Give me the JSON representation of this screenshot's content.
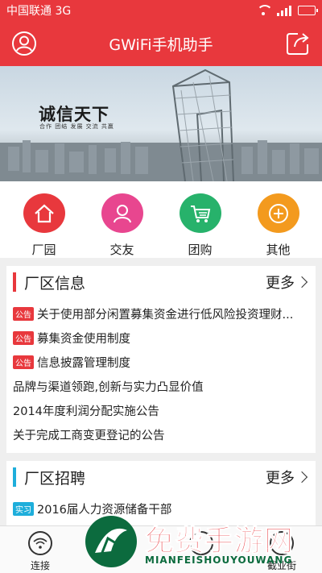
{
  "status_bar": {
    "carrier": "中国联通 3G",
    "battery_level": 0.9
  },
  "header": {
    "title": "GWiFi手机助手",
    "left_icon": "user-icon",
    "right_icon": "share-icon"
  },
  "banner": {
    "slogan": "诚信天下",
    "slogan_sub": "合作 团结 发展 交流 共赢"
  },
  "quick_menu": [
    {
      "label": "厂园",
      "icon": "home-icon",
      "color": "#e8383d"
    },
    {
      "label": "交友",
      "icon": "friends-icon",
      "color": "#e8468f"
    },
    {
      "label": "团购",
      "icon": "cart-icon",
      "color": "#27b26b"
    },
    {
      "label": "其他",
      "icon": "plus-icon",
      "color": "#f39a1e"
    }
  ],
  "news": {
    "title": "厂区信息",
    "more": "更多",
    "accent": "#e8383d",
    "items": [
      {
        "tag": "公告",
        "text": "关于使用部分闲置募集资金进行低风险投资理财..."
      },
      {
        "tag": "公告",
        "text": "募集资金使用制度"
      },
      {
        "tag": "公告",
        "text": "信息披露管理制度"
      },
      {
        "tag": "",
        "text": "品牌与渠道领跑,创新与实力凸显价值"
      },
      {
        "tag": "",
        "text": "2014年度利润分配实施公告"
      },
      {
        "tag": "",
        "text": "关于完成工商变更登记的公告"
      }
    ]
  },
  "jobs": {
    "title": "厂区招聘",
    "more": "更多",
    "accent": "#1eaedb",
    "items": [
      {
        "tag": "实习",
        "text": "2016届人力资源储备干部"
      }
    ]
  },
  "tab_bar": [
    {
      "label": "连接",
      "icon": "wifi-icon"
    },
    {
      "label": "",
      "icon": "discover-icon"
    },
    {
      "label": "",
      "icon": "app-icon"
    },
    {
      "label": "截业街",
      "icon": "street-icon"
    }
  ],
  "watermark": {
    "text": "免费手游网",
    "sub": "MIANFEISHOUYOUWANG"
  }
}
